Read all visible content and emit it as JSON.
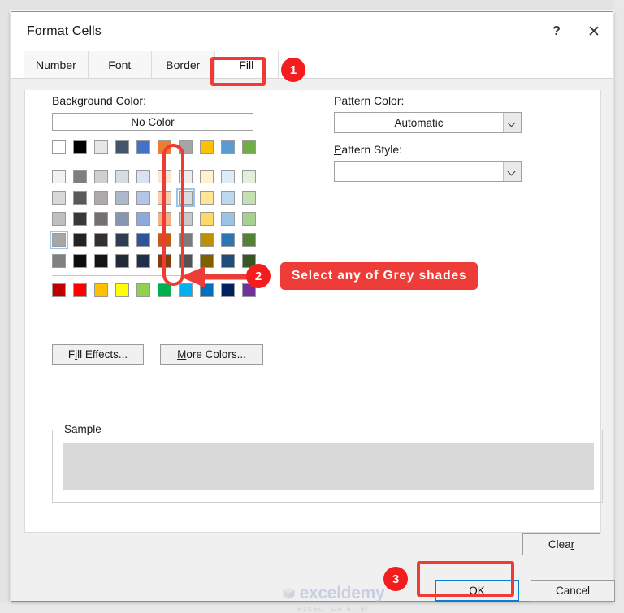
{
  "window": {
    "title": "Format Cells",
    "help_icon": "question-mark-icon",
    "close_icon": "close-icon"
  },
  "tabs": [
    {
      "label": "Number",
      "active": false
    },
    {
      "label": "Font",
      "active": false
    },
    {
      "label": "Border",
      "active": false
    },
    {
      "label": "Fill",
      "active": true
    }
  ],
  "fill_tab": {
    "background_color_label": "Background Color:",
    "background_color_accesskey": "C",
    "no_color_button": "No Color",
    "pattern_color_label": "Pattern Color:",
    "pattern_color_accesskey": "a",
    "pattern_color_value": "Automatic",
    "pattern_style_label": "Pattern Style:",
    "pattern_style_accesskey": "P",
    "pattern_style_value": "",
    "fill_effects_button": "Fill Effects...",
    "fill_effects_accesskey": "i",
    "more_colors_button": "More Colors...",
    "more_colors_accesskey": "M",
    "sample_group_label": "Sample",
    "sample_fill_color": "#d9d9d9",
    "clear_button": "Clear",
    "clear_accesskey": "r",
    "dropdown_icon": "chevron-down-icon"
  },
  "palette": {
    "standard_row_top": [
      "#ffffff",
      "#000000",
      "#e7e6e6",
      "#44546a",
      "#4472c4",
      "#ed7d31",
      "#a5a5a5",
      "#ffc000",
      "#5b9bd5",
      "#70ad47"
    ],
    "theme_rows": [
      [
        "#f2f2f2",
        "#7f7f7f",
        "#d0cece",
        "#d6dce4",
        "#d9e2f3",
        "#fbe5d5",
        "#ededed",
        "#fff2cc",
        "#ddebf6",
        "#e2efd9"
      ],
      [
        "#d8d8d8",
        "#595959",
        "#aeaaaa",
        "#adb9ca",
        "#b4c6e7",
        "#f7cbac",
        "#dbdbdb",
        "#ffe598",
        "#bdd7ee",
        "#c5e0b3"
      ],
      [
        "#bfbfbf",
        "#3b3838",
        "#757070",
        "#8496b0",
        "#8ea9db",
        "#f4b183",
        "#c9c9c9",
        "#ffd965",
        "#9cc3e5",
        "#a8d08d"
      ],
      [
        "#a6a6a6",
        "#212121",
        "#332f2f",
        "#2f3c51",
        "#2e5397",
        "#c55a11",
        "#7b7b7b",
        "#bf9000",
        "#2e75b5",
        "#538135"
      ],
      [
        "#808080",
        "#0d0d0d",
        "#161313",
        "#222a35",
        "#1f2f4d",
        "#833c0b",
        "#525252",
        "#7f6000",
        "#1f4e79",
        "#375623"
      ]
    ],
    "standard_row_bottom": [
      "#c00000",
      "#ff0000",
      "#ffc000",
      "#ffff00",
      "#92d050",
      "#00b050",
      "#00b0f0",
      "#0070c0",
      "#002060",
      "#7030a0"
    ],
    "selected_cell": {
      "row": 3,
      "col": 0
    },
    "selected_cell_b": {
      "row": 1,
      "col": 6
    },
    "highlighted_column_index": 6
  },
  "footer": {
    "ok_button": "OK",
    "cancel_button": "Cancel"
  },
  "annotations": {
    "badge_1": "1",
    "badge_2": "2",
    "badge_3": "3",
    "callout_text": "Select any of Grey shades",
    "accent_color": "#ef3b34",
    "badge_color": "#f41d1d",
    "focus_color": "#0a7cd6"
  },
  "watermark": {
    "name": "exceldemy",
    "tagline": "EXCEL · DATA · BI"
  }
}
